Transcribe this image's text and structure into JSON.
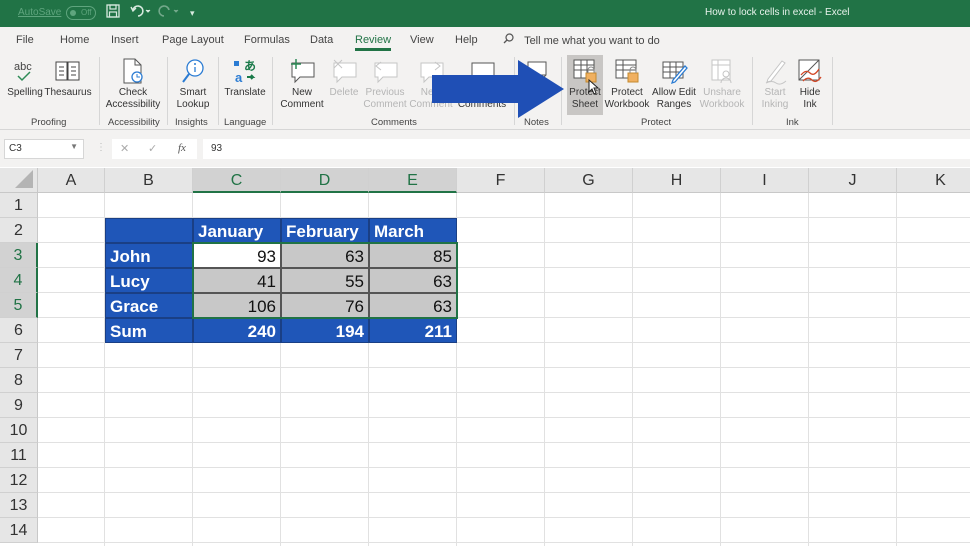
{
  "titlebar": {
    "autosave_label": "AutoSave",
    "autosave_state": "Off",
    "title": "How to lock cells in excel  -  Excel"
  },
  "tabs": [
    {
      "label": "File"
    },
    {
      "label": "Home"
    },
    {
      "label": "Insert"
    },
    {
      "label": "Page Layout"
    },
    {
      "label": "Formulas"
    },
    {
      "label": "Data"
    },
    {
      "label": "Review",
      "active": true
    },
    {
      "label": "View"
    },
    {
      "label": "Help"
    }
  ],
  "tell_me": "Tell me what you want to do",
  "ribbon": {
    "buttons": {
      "spelling": "Spelling",
      "thesaurus": "Thesaurus",
      "check_accessibility_1": "Check",
      "check_accessibility_2": "Accessibility",
      "smart_lookup_1": "Smart",
      "smart_lookup_2": "Lookup",
      "translate": "Translate",
      "new_comment_1": "New",
      "new_comment_2": "Comment",
      "delete": "Delete",
      "previous_comment_1": "Previous",
      "previous_comment_2": "Comment",
      "next_comment_1": "Next",
      "next_comment_2": "Comment",
      "show_comments": "Comments",
      "protect_sheet_1": "Protect",
      "protect_sheet_2": "Sheet",
      "protect_workbook_1": "Protect",
      "protect_workbook_2": "Workbook",
      "allow_edit_1": "Allow Edit",
      "allow_edit_2": "Ranges",
      "unshare_1": "Unshare",
      "unshare_2": "Workbook",
      "start_inking_1": "Start",
      "start_inking_2": "Inking",
      "hide_ink_1": "Hide",
      "hide_ink_2": "Ink"
    },
    "groups": {
      "proofing": "Proofing",
      "accessibility": "Accessibility",
      "insights": "Insights",
      "language": "Language",
      "comments": "Comments",
      "notes": "Notes",
      "protect": "Protect",
      "ink": "Ink"
    }
  },
  "formula_bar": {
    "name_box": "C3",
    "cancel_icon": "✕",
    "enter_icon": "✓",
    "fx_label": "fx",
    "value": "93"
  },
  "sheet": {
    "columns": [
      "A",
      "B",
      "C",
      "D",
      "E",
      "F",
      "G",
      "H",
      "I",
      "J",
      "K"
    ],
    "selected_columns": [
      "C",
      "D",
      "E"
    ],
    "rows": [
      "1",
      "2",
      "3",
      "4",
      "5",
      "6",
      "7",
      "8",
      "9",
      "10",
      "11",
      "12",
      "13",
      "14"
    ],
    "selected_rows": [
      "3",
      "4",
      "5"
    ],
    "table": {
      "headers": [
        "",
        "January",
        "February",
        "March"
      ],
      "data": [
        {
          "name": "John",
          "values": [
            "93",
            "63",
            "85"
          ]
        },
        {
          "name": "Lucy",
          "values": [
            "41",
            "55",
            "63"
          ]
        },
        {
          "name": "Grace",
          "values": [
            "106",
            "76",
            "63"
          ]
        }
      ],
      "sum": {
        "name": "Sum",
        "values": [
          "240",
          "194",
          "211"
        ]
      }
    },
    "active_cell": "C3",
    "selection": "C3:E5"
  },
  "colors": {
    "excel_green": "#217346",
    "table_blue": "#1f56b8",
    "arrow_blue": "#1f4fb5",
    "locked_gray": "#c8c8c8"
  }
}
